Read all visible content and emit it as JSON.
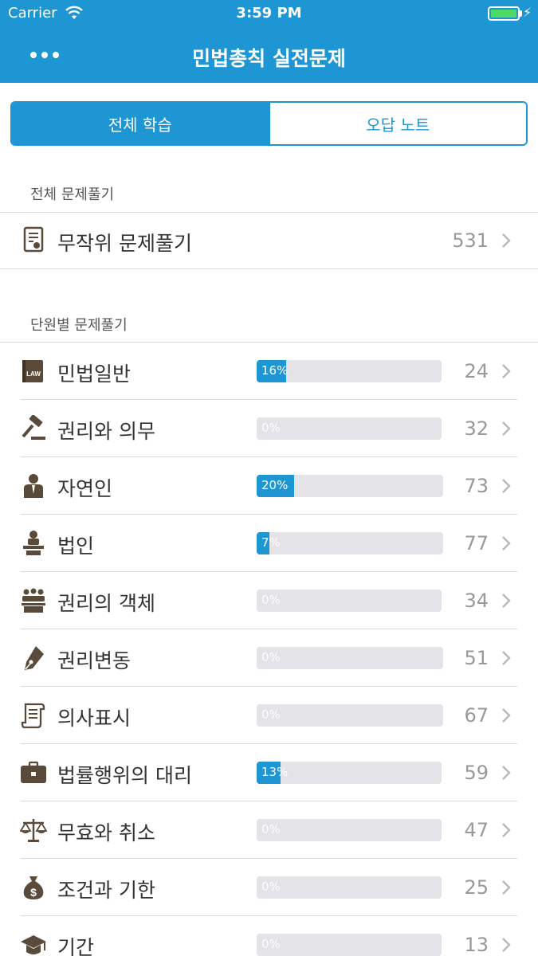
{
  "status_bar": {
    "carrier": "Carrier",
    "time": "3:59 PM"
  },
  "header": {
    "title": "민법총칙 실전문제"
  },
  "tabs": [
    {
      "label": "전체 학습",
      "active": true
    },
    {
      "label": "오답 노트",
      "active": false
    }
  ],
  "sections": {
    "all": "전체 문제풀기",
    "units": "단원별 문제풀기"
  },
  "random": {
    "label": "무작위 문제풀기",
    "count": "531",
    "icon": "certificate-icon"
  },
  "units": [
    {
      "label": "민법일반",
      "percent": 16,
      "percent_label": "16%",
      "count": "24",
      "icon": "law-book-icon"
    },
    {
      "label": "권리와 의무",
      "percent": 0,
      "percent_label": "0%",
      "count": "32",
      "icon": "gavel-icon"
    },
    {
      "label": "자연인",
      "percent": 20,
      "percent_label": "20%",
      "count": "73",
      "icon": "person-suit-icon"
    },
    {
      "label": "법인",
      "percent": 7,
      "percent_label": "7%",
      "count": "77",
      "icon": "podium-speaker-icon"
    },
    {
      "label": "권리의 객체",
      "percent": 0,
      "percent_label": "0%",
      "count": "34",
      "icon": "audience-icon"
    },
    {
      "label": "권리변동",
      "percent": 0,
      "percent_label": "0%",
      "count": "51",
      "icon": "fountain-pen-icon"
    },
    {
      "label": "의사표시",
      "percent": 0,
      "percent_label": "0%",
      "count": "67",
      "icon": "scroll-icon"
    },
    {
      "label": "법률행위의 대리",
      "percent": 13,
      "percent_label": "13%",
      "count": "59",
      "icon": "briefcase-icon"
    },
    {
      "label": "무효와 취소",
      "percent": 0,
      "percent_label": "0%",
      "count": "47",
      "icon": "scales-icon"
    },
    {
      "label": "조건과 기한",
      "percent": 0,
      "percent_label": "0%",
      "count": "25",
      "icon": "money-bag-icon"
    },
    {
      "label": "기간",
      "percent": 0,
      "percent_label": "0%",
      "count": "13",
      "icon": "graduation-cap-icon"
    }
  ],
  "colors": {
    "accent": "#1d96d3",
    "icon": "#5a4a3a",
    "track": "#e3e3e8"
  }
}
